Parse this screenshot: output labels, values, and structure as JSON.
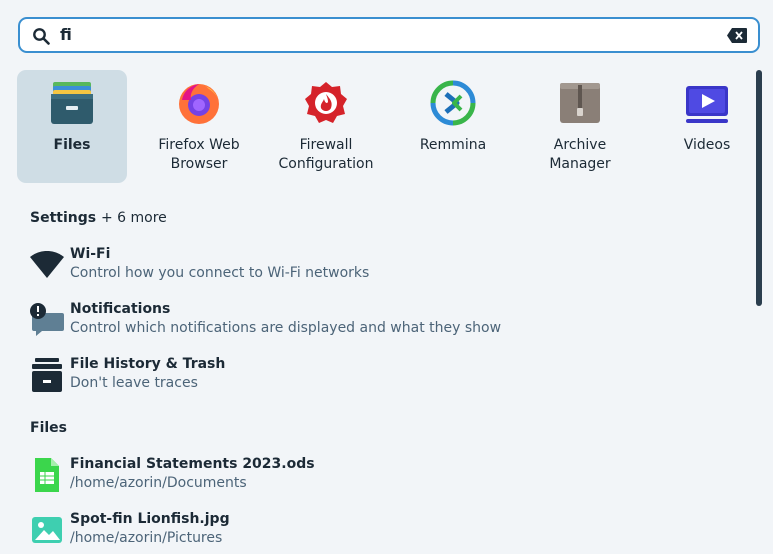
{
  "search": {
    "query": "fi"
  },
  "apps": [
    {
      "label": "Files",
      "icon": "files-icon",
      "selected": true
    },
    {
      "label": "Firefox Web Browser",
      "icon": "firefox-icon",
      "selected": false
    },
    {
      "label": "Firewall Configuration",
      "icon": "firewall-icon",
      "selected": false
    },
    {
      "label": "Remmina",
      "icon": "remmina-icon",
      "selected": false
    },
    {
      "label": "Archive Manager",
      "icon": "archive-manager-icon",
      "selected": false
    },
    {
      "label": "Videos",
      "icon": "videos-icon",
      "selected": false
    }
  ],
  "settings": {
    "title": "Settings",
    "more": "+ 6 more",
    "items": [
      {
        "title": "Wi-Fi",
        "subtitle": "Control how you connect to Wi-Fi networks",
        "icon": "wifi-icon"
      },
      {
        "title": "Notifications",
        "subtitle": "Control which notifications are displayed and what they show",
        "icon": "notifications-icon"
      },
      {
        "title": "File History & Trash",
        "subtitle": "Don't leave traces",
        "icon": "file-history-trash-icon"
      }
    ]
  },
  "files": {
    "title": "Files",
    "items": [
      {
        "title": "Financial Statements 2023.ods",
        "subtitle": "/home/azorin/Documents",
        "icon": "spreadsheet-icon"
      },
      {
        "title": "Spot-fin Lionfish.jpg",
        "subtitle": "/home/azorin/Pictures",
        "icon": "image-icon"
      }
    ]
  },
  "colors": {
    "accent": "#3a8fd0",
    "selected_bg": "#cfdde5",
    "background": "#f2f5f8",
    "subtitle": "#4c6478"
  }
}
